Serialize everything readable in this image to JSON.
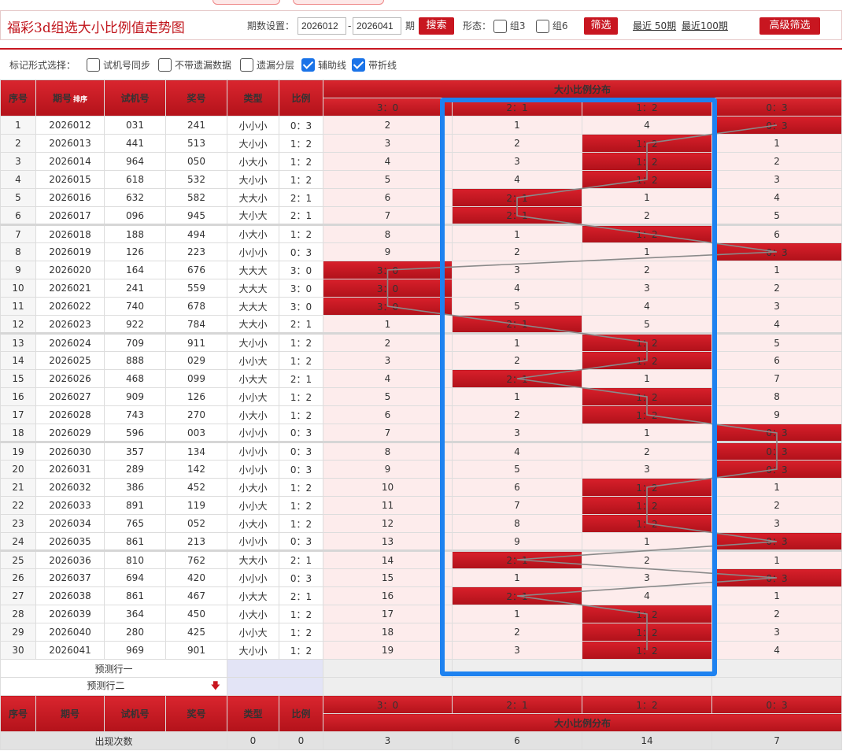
{
  "header": {
    "title": "福彩3d组选大小比例值走势图",
    "period_label": "期数设置：",
    "period_from": "2026012",
    "period_dash": "-",
    "period_to": "2026041",
    "period_unit": "期",
    "search_label": "搜索",
    "form_label": "形态：",
    "group3_label": "组3",
    "group6_label": "组6",
    "filter_label": "筛选",
    "recent50_label": "最近 50期",
    "recent100_label": "最近100期",
    "advanced_label": "高级筛选"
  },
  "options": {
    "label": "标记形式选择：",
    "items": [
      {
        "label": "试机号同步",
        "checked": false
      },
      {
        "label": "不带遗漏数据",
        "checked": false
      },
      {
        "label": "遗漏分层",
        "checked": false
      },
      {
        "label": "辅助线",
        "checked": true
      },
      {
        "label": "带折线",
        "checked": true
      }
    ]
  },
  "table": {
    "headers": {
      "seq": "序号",
      "period": "期号",
      "sort": "排序",
      "trial": "试机号",
      "prize": "奖号",
      "type": "类型",
      "ratio": "比例",
      "dist": "大小比例分布"
    },
    "ratio_columns": [
      "3：0",
      "2：1",
      "1：2",
      "0：3"
    ],
    "rows": [
      {
        "seq": "1",
        "period": "2026012",
        "trial": "031",
        "prize": "241",
        "type": "小小小",
        "ratio": "0：3",
        "hit": 3,
        "cells": [
          "2",
          "1",
          "4",
          "0：3"
        ]
      },
      {
        "seq": "2",
        "period": "2026013",
        "trial": "441",
        "prize": "513",
        "type": "大小小",
        "ratio": "1：2",
        "hit": 2,
        "cells": [
          "3",
          "2",
          "1：2",
          "1"
        ]
      },
      {
        "seq": "3",
        "period": "2026014",
        "trial": "964",
        "prize": "050",
        "type": "小大小",
        "ratio": "1：2",
        "hit": 2,
        "cells": [
          "4",
          "3",
          "1：2",
          "2"
        ]
      },
      {
        "seq": "4",
        "period": "2026015",
        "trial": "618",
        "prize": "532",
        "type": "大小小",
        "ratio": "1：2",
        "hit": 2,
        "cells": [
          "5",
          "4",
          "1：2",
          "3"
        ]
      },
      {
        "seq": "5",
        "period": "2026016",
        "trial": "632",
        "prize": "582",
        "type": "大大小",
        "ratio": "2：1",
        "hit": 1,
        "cells": [
          "6",
          "2：1",
          "1",
          "4"
        ]
      },
      {
        "seq": "6",
        "period": "2026017",
        "trial": "096",
        "prize": "945",
        "type": "大小大",
        "ratio": "2：1",
        "hit": 1,
        "cells": [
          "7",
          "2：1",
          "2",
          "5"
        ]
      },
      {
        "seq": "7",
        "period": "2026018",
        "trial": "188",
        "prize": "494",
        "type": "小大小",
        "ratio": "1：2",
        "hit": 2,
        "cells": [
          "8",
          "1",
          "1：2",
          "6"
        ]
      },
      {
        "seq": "8",
        "period": "2026019",
        "trial": "126",
        "prize": "223",
        "type": "小小小",
        "ratio": "0：3",
        "hit": 3,
        "cells": [
          "9",
          "2",
          "1",
          "0：3"
        ]
      },
      {
        "seq": "9",
        "period": "2026020",
        "trial": "164",
        "prize": "676",
        "type": "大大大",
        "ratio": "3：0",
        "hit": 0,
        "cells": [
          "3：0",
          "3",
          "2",
          "1"
        ]
      },
      {
        "seq": "10",
        "period": "2026021",
        "trial": "241",
        "prize": "559",
        "type": "大大大",
        "ratio": "3：0",
        "hit": 0,
        "cells": [
          "3：0",
          "4",
          "3",
          "2"
        ]
      },
      {
        "seq": "11",
        "period": "2026022",
        "trial": "740",
        "prize": "678",
        "type": "大大大",
        "ratio": "3：0",
        "hit": 0,
        "cells": [
          "3：0",
          "5",
          "4",
          "3"
        ]
      },
      {
        "seq": "12",
        "period": "2026023",
        "trial": "922",
        "prize": "784",
        "type": "大大小",
        "ratio": "2：1",
        "hit": 1,
        "cells": [
          "1",
          "2：1",
          "5",
          "4"
        ]
      },
      {
        "seq": "13",
        "period": "2026024",
        "trial": "709",
        "prize": "911",
        "type": "大小小",
        "ratio": "1：2",
        "hit": 2,
        "cells": [
          "2",
          "1",
          "1：2",
          "5"
        ]
      },
      {
        "seq": "14",
        "period": "2026025",
        "trial": "888",
        "prize": "029",
        "type": "小小大",
        "ratio": "1：2",
        "hit": 2,
        "cells": [
          "3",
          "2",
          "1：2",
          "6"
        ]
      },
      {
        "seq": "15",
        "period": "2026026",
        "trial": "468",
        "prize": "099",
        "type": "小大大",
        "ratio": "2：1",
        "hit": 1,
        "cells": [
          "4",
          "2：1",
          "1",
          "7"
        ]
      },
      {
        "seq": "16",
        "period": "2026027",
        "trial": "909",
        "prize": "126",
        "type": "小小大",
        "ratio": "1：2",
        "hit": 2,
        "cells": [
          "5",
          "1",
          "1：2",
          "8"
        ]
      },
      {
        "seq": "17",
        "period": "2026028",
        "trial": "743",
        "prize": "270",
        "type": "小大小",
        "ratio": "1：2",
        "hit": 2,
        "cells": [
          "6",
          "2",
          "1：2",
          "9"
        ]
      },
      {
        "seq": "18",
        "period": "2026029",
        "trial": "596",
        "prize": "003",
        "type": "小小小",
        "ratio": "0：3",
        "hit": 3,
        "cells": [
          "7",
          "3",
          "1",
          "0：3"
        ]
      },
      {
        "seq": "19",
        "period": "2026030",
        "trial": "357",
        "prize": "134",
        "type": "小小小",
        "ratio": "0：3",
        "hit": 3,
        "cells": [
          "8",
          "4",
          "2",
          "0：3"
        ]
      },
      {
        "seq": "20",
        "period": "2026031",
        "trial": "289",
        "prize": "142",
        "type": "小小小",
        "ratio": "0：3",
        "hit": 3,
        "cells": [
          "9",
          "5",
          "3",
          "0：3"
        ]
      },
      {
        "seq": "21",
        "period": "2026032",
        "trial": "386",
        "prize": "452",
        "type": "小大小",
        "ratio": "1：2",
        "hit": 2,
        "cells": [
          "10",
          "6",
          "1：2",
          "1"
        ]
      },
      {
        "seq": "22",
        "period": "2026033",
        "trial": "891",
        "prize": "119",
        "type": "小小大",
        "ratio": "1：2",
        "hit": 2,
        "cells": [
          "11",
          "7",
          "1：2",
          "2"
        ]
      },
      {
        "seq": "23",
        "period": "2026034",
        "trial": "765",
        "prize": "052",
        "type": "小大小",
        "ratio": "1：2",
        "hit": 2,
        "cells": [
          "12",
          "8",
          "1：2",
          "3"
        ]
      },
      {
        "seq": "24",
        "period": "2026035",
        "trial": "861",
        "prize": "213",
        "type": "小小小",
        "ratio": "0：3",
        "hit": 3,
        "cells": [
          "13",
          "9",
          "1",
          "0：3"
        ]
      },
      {
        "seq": "25",
        "period": "2026036",
        "trial": "810",
        "prize": "762",
        "type": "大大小",
        "ratio": "2：1",
        "hit": 1,
        "cells": [
          "14",
          "2：1",
          "2",
          "1"
        ]
      },
      {
        "seq": "26",
        "period": "2026037",
        "trial": "694",
        "prize": "420",
        "type": "小小小",
        "ratio": "0：3",
        "hit": 3,
        "cells": [
          "15",
          "1",
          "3",
          "0：3"
        ]
      },
      {
        "seq": "27",
        "period": "2026038",
        "trial": "861",
        "prize": "467",
        "type": "小大大",
        "ratio": "2：1",
        "hit": 1,
        "cells": [
          "16",
          "2：1",
          "4",
          "1"
        ]
      },
      {
        "seq": "28",
        "period": "2026039",
        "trial": "364",
        "prize": "450",
        "type": "小大小",
        "ratio": "1：2",
        "hit": 2,
        "cells": [
          "17",
          "1",
          "1：2",
          "2"
        ]
      },
      {
        "seq": "29",
        "period": "2026040",
        "trial": "280",
        "prize": "425",
        "type": "小小大",
        "ratio": "1：2",
        "hit": 2,
        "cells": [
          "18",
          "2",
          "1：2",
          "3"
        ]
      },
      {
        "seq": "30",
        "period": "2026041",
        "trial": "969",
        "prize": "901",
        "type": "大小小",
        "ratio": "1：2",
        "hit": 2,
        "cells": [
          "19",
          "3",
          "1：2",
          "4"
        ]
      }
    ],
    "predict1": "预测行一",
    "predict2": "预测行二",
    "predict_arrow": "🡇",
    "footer": {
      "label": "出现次数",
      "type_count": "0",
      "ratio_count": "0",
      "counts": [
        "3",
        "6",
        "14",
        "7"
      ]
    }
  },
  "colors": {
    "brand_red": "#c81620",
    "highlight_blue": "#1e82f0"
  }
}
